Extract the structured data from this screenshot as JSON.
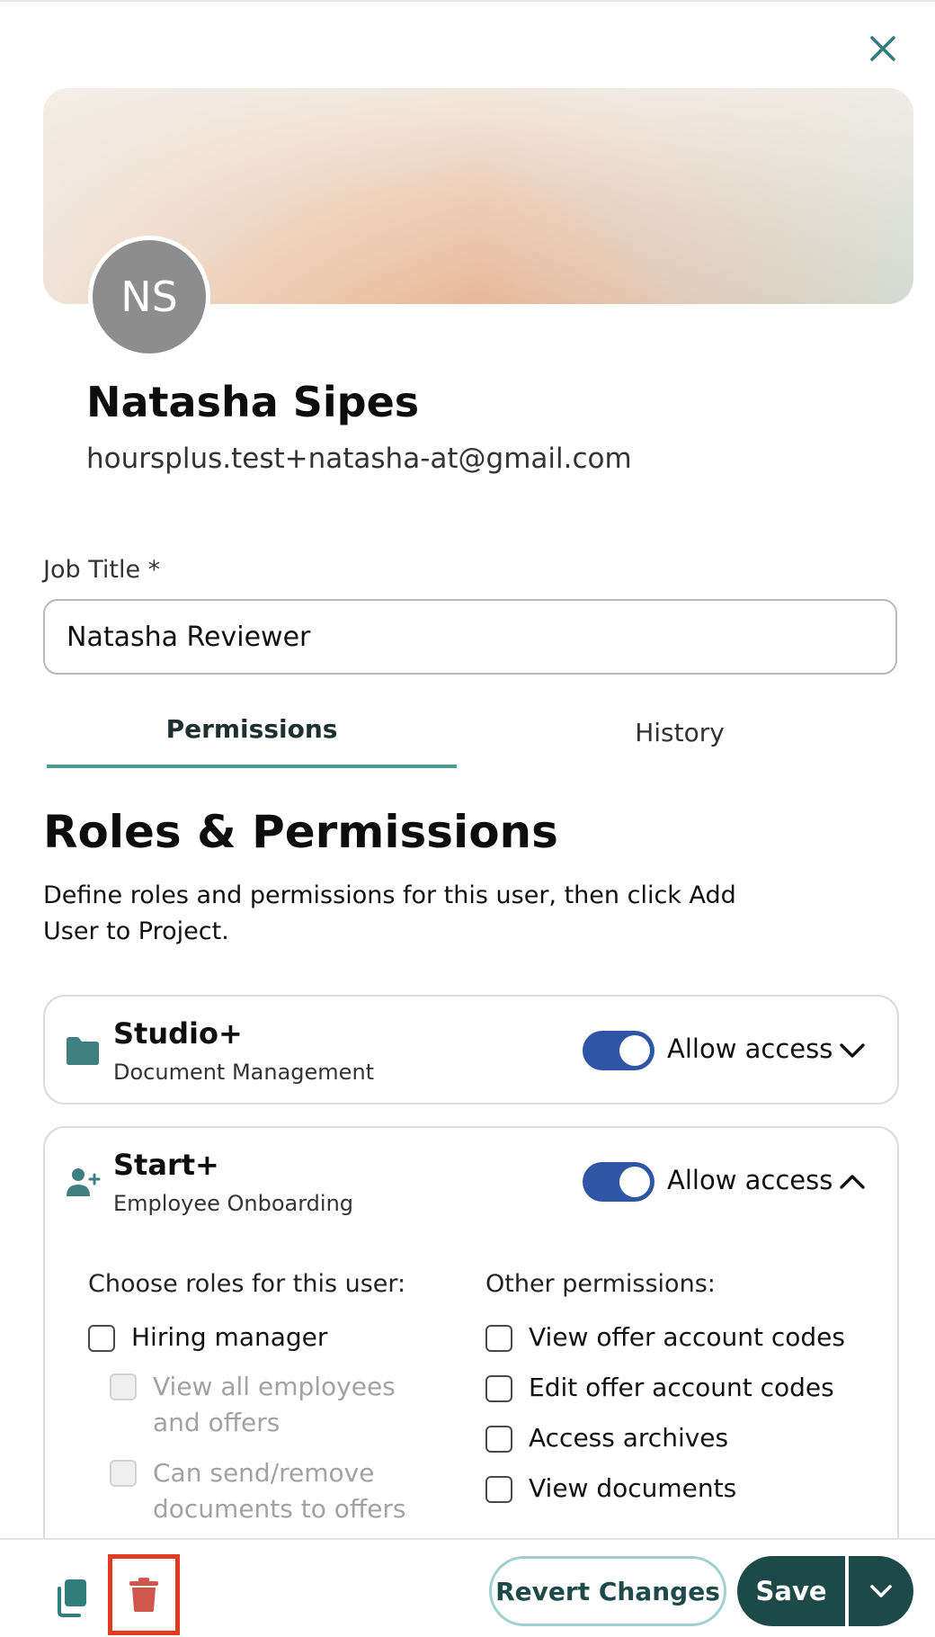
{
  "icons": {
    "close": "close-icon",
    "folder": "folder-icon",
    "add_user": "add-user-icon",
    "chevron_down": "chevron-down-icon",
    "chevron_up": "chevron-up-icon",
    "copy": "copy-icon",
    "trash": "trash-icon"
  },
  "colors": {
    "accent_teal": "#4f9a9c",
    "toggle_blue": "#2f56a4",
    "save_dark": "#1d4a48",
    "revert_border": "#9fd0cd",
    "highlight_red": "#e33b22",
    "trash_red": "#d0554a"
  },
  "profile": {
    "initials": "NS",
    "name": "Natasha Sipes",
    "email": "hoursplus.test+natasha-at@gmail.com"
  },
  "job": {
    "label": "Job Title *",
    "value": "Natasha Reviewer"
  },
  "tabs": [
    {
      "label": "Permissions",
      "active": true
    },
    {
      "label": "History",
      "active": false
    }
  ],
  "section": {
    "title": "Roles & Permissions",
    "description": "Define roles and permissions for this user, then click Add User to Project."
  },
  "modules": [
    {
      "title": "Studio+",
      "subtitle": "Document Management",
      "access_label": "Allow access",
      "access_enabled": true,
      "expanded": false
    },
    {
      "title": "Start+",
      "subtitle": "Employee Onboarding",
      "access_label": "Allow access",
      "access_enabled": true,
      "expanded": true,
      "roles_heading": "Choose roles for this user:",
      "roles": [
        {
          "label": "Hiring manager",
          "checked": false,
          "disabled": false
        },
        {
          "label": "View all employees and offers",
          "checked": false,
          "disabled": true
        },
        {
          "label": "Can send/remove documents to offers",
          "checked": false,
          "disabled": true
        }
      ],
      "other_heading": "Other permissions:",
      "other_permissions": [
        {
          "label": "View offer account codes",
          "checked": false
        },
        {
          "label": "Edit offer account codes",
          "checked": false
        },
        {
          "label": "Access archives",
          "checked": false
        },
        {
          "label": "View documents",
          "checked": false
        }
      ]
    }
  ],
  "footer": {
    "revert_label": "Revert Changes",
    "save_label": "Save"
  }
}
